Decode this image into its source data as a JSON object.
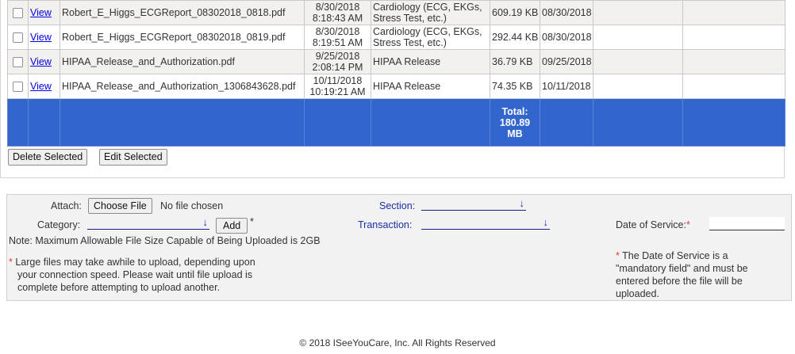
{
  "files": [
    {
      "view_label": "View",
      "filename": "Robert_E_Higgs_ECGReport_08302018_0818.pdf",
      "date": "8/30/2018",
      "time": "8:18:43 AM",
      "section": "Cardiology (ECG, EKGs, Stress Test, etc.)",
      "size": "609.19 KB",
      "service_date": "08/30/2018"
    },
    {
      "view_label": "View",
      "filename": "Robert_E_Higgs_ECGReport_08302018_0819.pdf",
      "date": "8/30/2018",
      "time": "8:19:51 AM",
      "section": "Cardiology (ECG, EKGs, Stress Test, etc.)",
      "size": "292.44 KB",
      "service_date": "08/30/2018"
    },
    {
      "view_label": "View",
      "filename": "HIPAA_Release_and_Authorization.pdf",
      "date": "9/25/2018",
      "time": "2:08:14 PM",
      "section": "HIPAA Release",
      "size": "36.79 KB",
      "service_date": "09/25/2018"
    },
    {
      "view_label": "View",
      "filename": "HIPAA_Release_and_Authorization_1306843628.pdf",
      "date": "10/11/2018",
      "time": "10:19:21 AM",
      "section": "HIPAA Release",
      "size": "74.35 KB",
      "service_date": "10/11/2018"
    }
  ],
  "total": {
    "label": "Total:",
    "value": "180.89",
    "unit": "MB"
  },
  "actions": {
    "delete_label": "Delete Selected",
    "edit_label": "Edit Selected"
  },
  "upload": {
    "attach_label": "Attach:",
    "choose_file_label": "Choose File",
    "no_file_text": "No file chosen",
    "section_label": "Section:",
    "category_label": "Category:",
    "add_label": "Add",
    "required_mark": "*",
    "transaction_label": "Transaction:",
    "date_of_service_label": "Date of Service:",
    "note": "Note: Maximum Allowable File Size Capable of Being Uploaded is 2GB",
    "large_files_l1": "Large files may take awhile to upload, depending upon",
    "large_files_l2": "your connection speed. Please wait until file upload is",
    "large_files_l3": "complete before attempting to upload another.",
    "dos_note_l1": "The Date of Service is a",
    "dos_note_l2": "\"mandatory field\" and must be",
    "dos_note_l3": "entered before the file will be",
    "dos_note_l4": "uploaded."
  },
  "footer": {
    "text": "© 2018 ISeeYouCare, Inc. All Rights Reserved"
  },
  "colors": {
    "total_row": "#3366cc",
    "link": "#0000ee",
    "label_blue": "#1a2fa8",
    "required": "#e23b3b"
  }
}
